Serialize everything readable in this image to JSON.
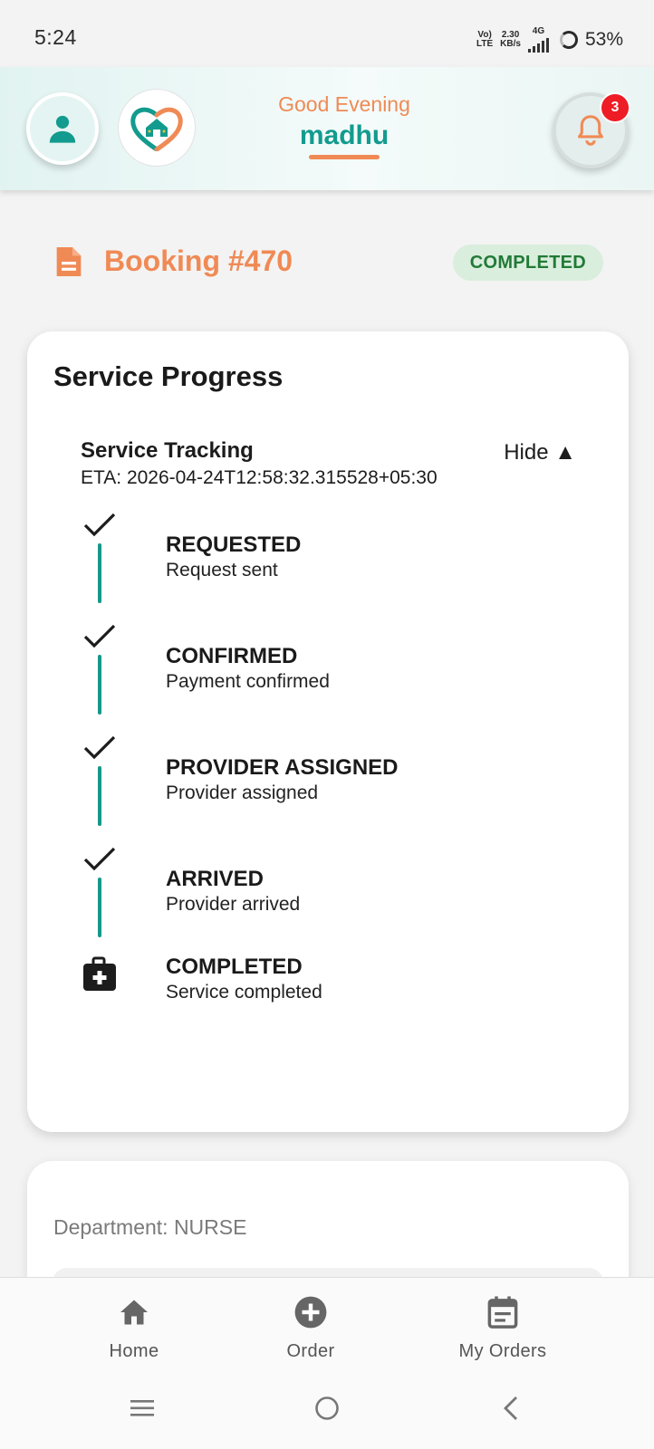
{
  "status_bar": {
    "time": "5:24",
    "volte_top": "Vo)",
    "volte_bottom": "LTE",
    "speed_top": "2.30",
    "speed_bottom": "KB/s",
    "network": "4G",
    "battery": "53%"
  },
  "header": {
    "greeting": "Good Evening",
    "user_name": "madhu",
    "notification_count": "3"
  },
  "booking": {
    "title": "Booking #470",
    "status": "COMPLETED"
  },
  "progress_card": {
    "title": "Service Progress",
    "tracking_title": "Service Tracking",
    "eta": "ETA: 2026-04-24T12:58:32.315528+05:30",
    "toggle_label": "Hide ▲",
    "steps": [
      {
        "name": "REQUESTED",
        "desc": "Request sent"
      },
      {
        "name": "CONFIRMED",
        "desc": "Payment confirmed"
      },
      {
        "name": "PROVIDER ASSIGNED",
        "desc": "Provider assigned"
      },
      {
        "name": "ARRIVED",
        "desc": "Provider arrived"
      },
      {
        "name": "COMPLETED",
        "desc": "Service completed"
      }
    ]
  },
  "details_card": {
    "department": "Department: NURSE"
  },
  "bottom_nav": {
    "items": [
      {
        "label": "Home",
        "icon": "home-icon"
      },
      {
        "label": "Order",
        "icon": "add-circle-icon"
      },
      {
        "label": "My Orders",
        "icon": "calendar-icon"
      }
    ]
  },
  "colors": {
    "brand_teal": "#129b8e",
    "brand_orange": "#f08a55",
    "status_green": "#227a37",
    "badge_red": "#ee1c24"
  }
}
